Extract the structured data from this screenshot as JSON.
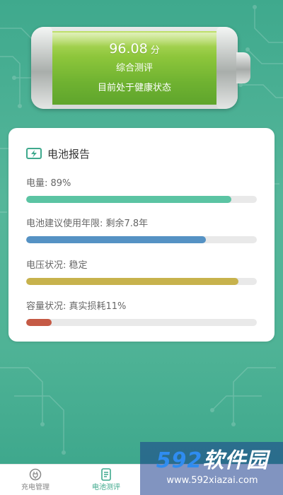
{
  "battery": {
    "score": "96.08",
    "score_unit": "分",
    "score_label": "综合测评",
    "status": "目前处于健康状态"
  },
  "report": {
    "title": "电池报告",
    "metrics": [
      {
        "label": "电量: 89%",
        "fill": 0.89,
        "color": "#5bc4a3"
      },
      {
        "label": "电池建议使用年限: 剩余7.8年",
        "fill": 0.78,
        "color": "#5592c4"
      },
      {
        "label": "电压状况: 稳定",
        "fill": 0.92,
        "color": "#c7b24c"
      },
      {
        "label": "容量状况: 真实损耗11%",
        "fill": 0.11,
        "color": "#c55a45"
      }
    ]
  },
  "nav": {
    "items": [
      {
        "label": "充电管理",
        "icon": "plug-icon"
      },
      {
        "label": "电池测评",
        "icon": "report-icon"
      }
    ]
  },
  "watermark": {
    "brand_num": "592",
    "brand_text": "软件园",
    "url": "www.592xiazai.com"
  },
  "colors": {
    "accent": "#3fa98d"
  }
}
